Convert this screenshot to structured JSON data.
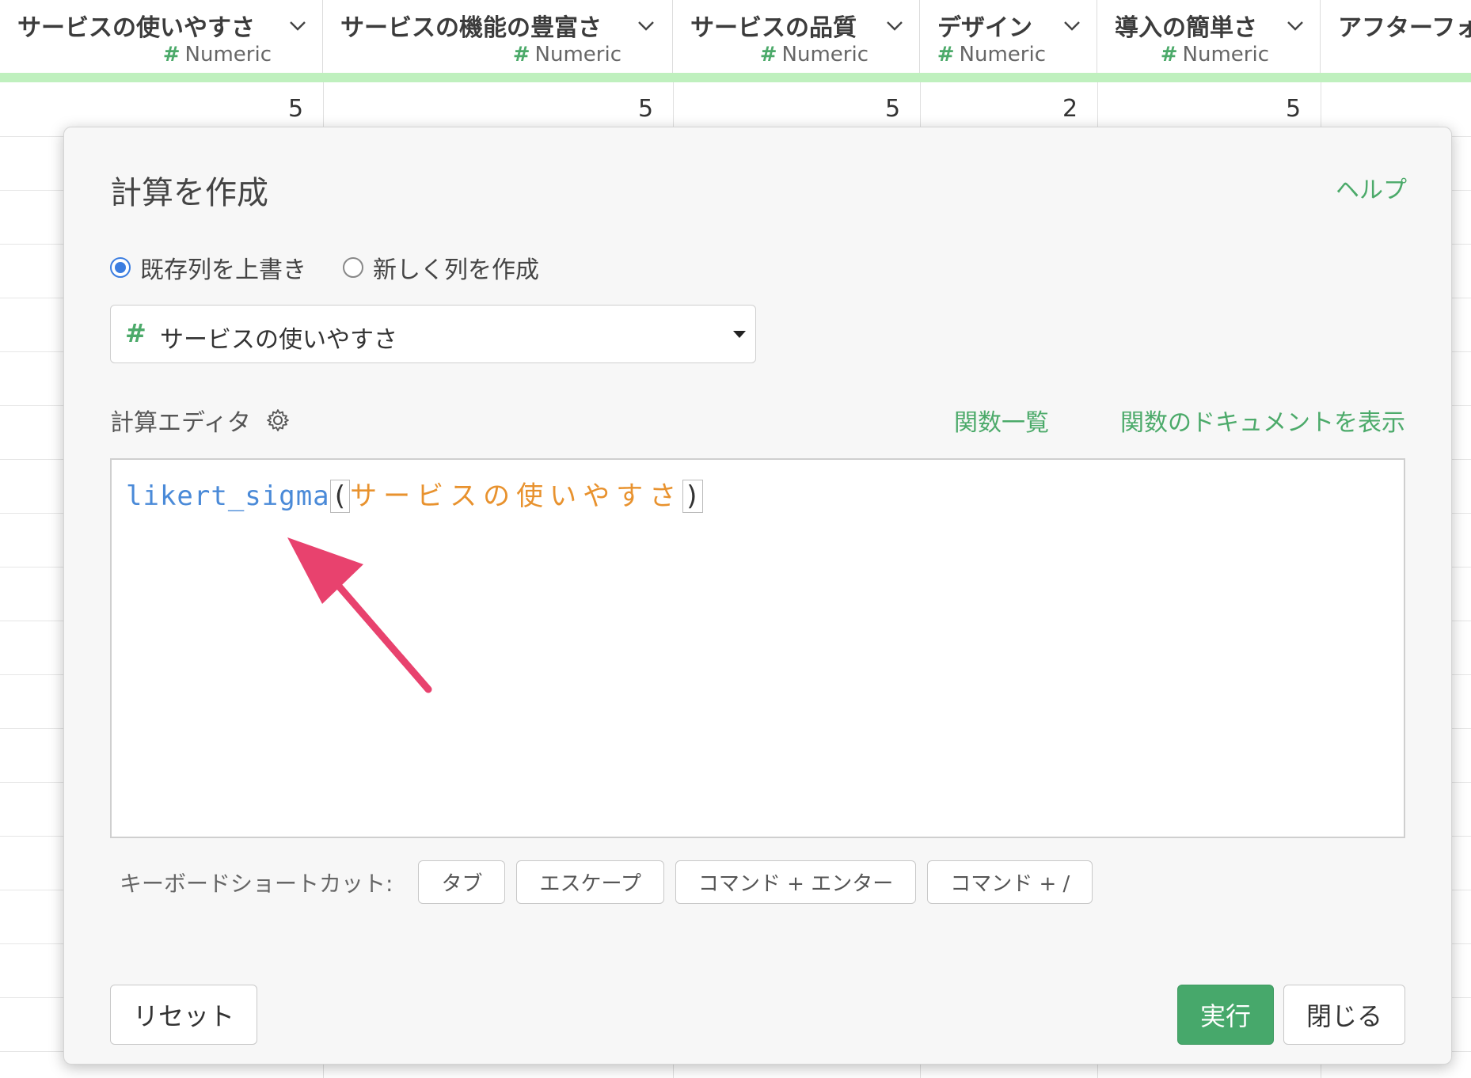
{
  "columns": [
    {
      "title": "サービスの使いやすさ",
      "type": "Numeric",
      "value": "5"
    },
    {
      "title": "サービスの機能の豊富さ",
      "type": "Numeric",
      "value": "5"
    },
    {
      "title": "サービスの品質",
      "type": "Numeric",
      "value": "5"
    },
    {
      "title": "デザイン",
      "type": "Numeric",
      "value": "2"
    },
    {
      "title": "導入の簡単さ",
      "type": "Numeric",
      "value": "5"
    },
    {
      "title": "アフターフォ"
    }
  ],
  "dialog": {
    "title": "計算を作成",
    "help": "ヘルプ",
    "radio_overwrite": "既存列を上書き",
    "radio_new": "新しく列を作成",
    "selected_column": "サービスの使いやすさ",
    "editor_label": "計算エディタ",
    "fn_list": "関数一覧",
    "fn_docs": "関数のドキュメントを表示",
    "code": {
      "fn": "likert_sigma",
      "open": "(",
      "arg": "サービスの使いやすさ",
      "close": ")"
    },
    "shortcuts_label": "キーボードショートカット:",
    "shortcuts": [
      "タブ",
      "エスケープ",
      "コマンド + エンター",
      "コマンド + /"
    ],
    "reset": "リセット",
    "run": "実行",
    "close": "閉じる"
  },
  "colors": {
    "accent": "#4caa6a",
    "run_button": "#47a86b",
    "radio": "#3b7de0",
    "fn": "#4a8ad8",
    "arg": "#e8922e",
    "arrow": "#e8426e"
  },
  "icons": {
    "gear": "gear-icon",
    "chevron": "chevron-down-icon",
    "hash": "numeric-hash-icon"
  }
}
